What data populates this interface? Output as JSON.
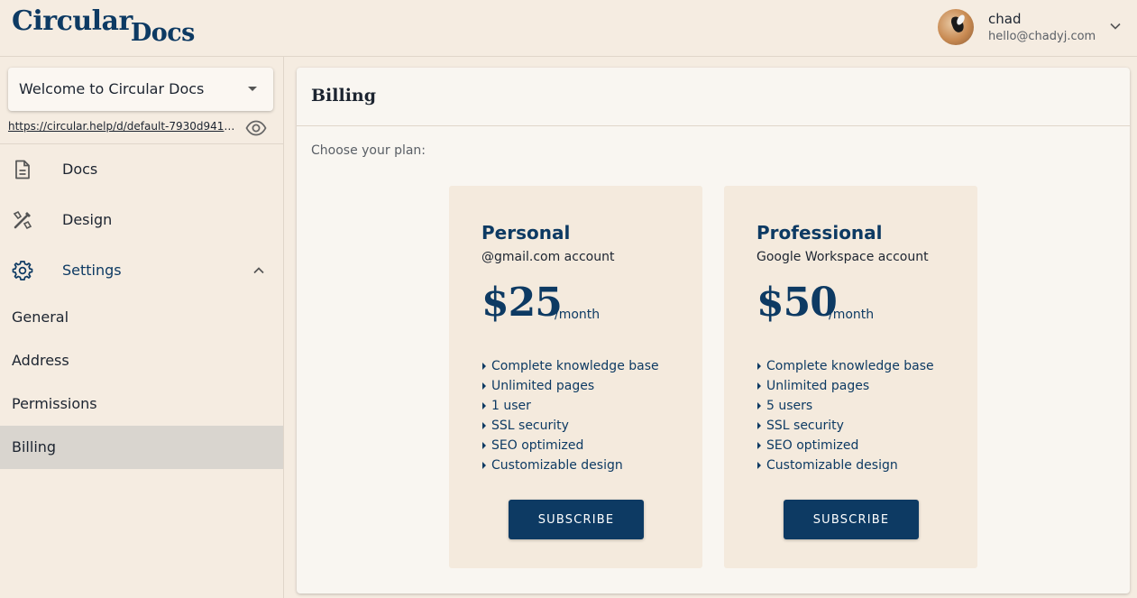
{
  "header": {
    "logo_part1": "Circular",
    "logo_part2": "Docs",
    "user_name": "chad",
    "user_email": "hello@chadyj.com"
  },
  "sidebar": {
    "site_select_value": "Welcome to Circular Docs",
    "site_url": "https://circular.help/d/default-7930d9410…",
    "nav": [
      {
        "label": "Docs",
        "icon": "document-icon"
      },
      {
        "label": "Design",
        "icon": "design-tools-icon"
      },
      {
        "label": "Settings",
        "icon": "gear-icon",
        "expanded": true
      }
    ],
    "settings_items": [
      {
        "label": "General"
      },
      {
        "label": "Address"
      },
      {
        "label": "Permissions"
      },
      {
        "label": "Billing",
        "selected": true
      }
    ]
  },
  "main": {
    "title": "Billing",
    "subtitle": "Choose your plan:",
    "plans": [
      {
        "name": "Personal",
        "account": "@gmail.com account",
        "price": "$25",
        "period": "/month",
        "features": [
          "Complete knowledge base",
          "Unlimited pages",
          "1 user",
          "SSL security",
          "SEO optimized",
          "Customizable design"
        ],
        "button": "SUBSCRIBE"
      },
      {
        "name": "Professional",
        "account": "Google Workspace account",
        "price": "$50",
        "period": "/month",
        "features": [
          "Complete knowledge base",
          "Unlimited pages",
          "5 users",
          "SSL security",
          "SEO optimized",
          "Customizable design"
        ],
        "button": "SUBSCRIBE"
      }
    ]
  },
  "colors": {
    "background": "#f5ece1",
    "accent": "#0d3a63",
    "card": "#f9f6f1",
    "plan_card": "#f4eadd",
    "selected_item": "#d9d5cf"
  }
}
